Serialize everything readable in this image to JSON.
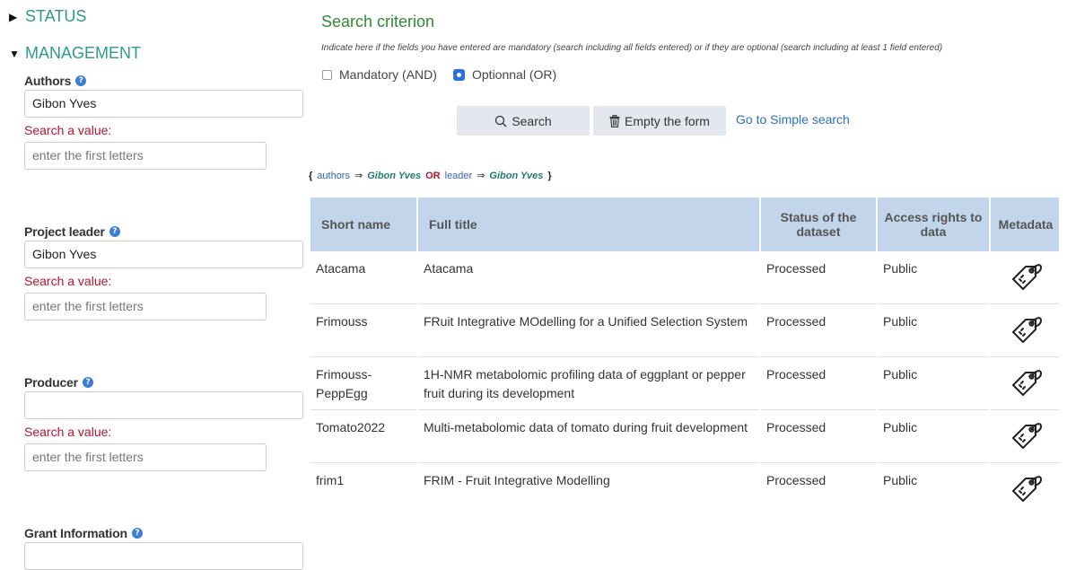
{
  "sections": {
    "status": {
      "label": "STATUS",
      "expanded": false
    },
    "management": {
      "label": "MANAGEMENT",
      "expanded": true
    }
  },
  "fields": {
    "authors": {
      "label": "Authors",
      "value": "Gibon Yves",
      "search_label": "Search a value:",
      "placeholder": "enter the first letters"
    },
    "project_leader": {
      "label": "Project leader",
      "value": "Gibon Yves",
      "search_label": "Search a value:",
      "placeholder": "enter the first letters"
    },
    "producer": {
      "label": "Producer",
      "value": "",
      "search_label": "Search a value:",
      "placeholder": "enter the first letters"
    },
    "grant_information": {
      "label": "Grant Information",
      "value": ""
    }
  },
  "criterion": {
    "title": "Search criterion",
    "hint": "Indicate here if the fields you have entered are mandatory (search including all fields entered) or if they are optional (search including at least 1 field entered)",
    "mandatory_label": "Mandatory (AND)",
    "optional_label": "Optionnal (OR)",
    "selected": "optional"
  },
  "actions": {
    "search_label": "Search",
    "empty_label": "Empty the form",
    "simple_search_link": "Go to Simple search"
  },
  "query": {
    "open": "{",
    "key1": "authors",
    "arrow": "⇒",
    "val1": "Gibon Yves",
    "op": "OR",
    "key2": "leader",
    "val2": "Gibon Yves",
    "close": "}"
  },
  "table": {
    "headers": {
      "short_name": "Short name",
      "full_title": "Full title",
      "status": "Status of the dataset",
      "access": "Access rights to data",
      "metadata": "Metadata"
    },
    "rows": [
      {
        "short": "Atacama",
        "title": "Atacama",
        "status": "Processed",
        "access": "Public"
      },
      {
        "short": "Frimouss",
        "title": "FRuit Integrative MOdelling for a Unified Selection System",
        "status": "Processed",
        "access": "Public"
      },
      {
        "short": "Frimouss-PeppEgg",
        "title": "1H-NMR metabolomic profiling data of eggplant or pepper fruit during its development",
        "status": "Processed",
        "access": "Public"
      },
      {
        "short": "Tomato2022",
        "title": "Multi-metabolomic data of tomato during fruit development",
        "status": "Processed",
        "access": "Public"
      },
      {
        "short": "frim1",
        "title": "FRIM - Fruit Integrative Modelling",
        "status": "Processed",
        "access": "Public"
      }
    ]
  }
}
